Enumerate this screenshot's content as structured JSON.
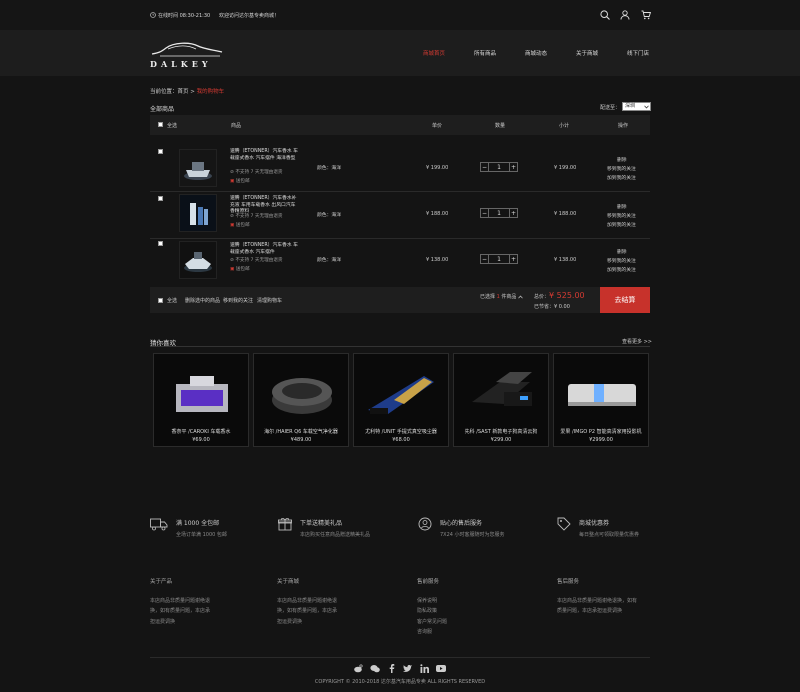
{
  "topbar": {
    "hours": "在线时间 08:30-21:30",
    "welcome": "欢迎访问达尔基专卖商城！"
  },
  "nav": {
    "logo_text": "DALKEY",
    "items": [
      {
        "label": "商城首页",
        "active": true
      },
      {
        "label": "所有商品",
        "active": false
      },
      {
        "label": "商城动态",
        "active": false
      },
      {
        "label": "关于商城",
        "active": false
      },
      {
        "label": "线下门店",
        "active": false
      }
    ]
  },
  "breadcrumb": {
    "prefix": "当前位置：",
    "home": "首页",
    "sep": ">",
    "current": "我的购物车"
  },
  "cart": {
    "heading": "全部商品",
    "ship_label": "配送至：",
    "ship_value": "深圳",
    "columns": [
      "全选",
      "商品",
      "单价",
      "数量",
      "小计",
      "操作"
    ],
    "items": [
      {
        "name": "速腾（ETONNER）汽车香水 车载座式香水 汽车摆件 海洋香型",
        "note": "不支持 7 天无理由退货",
        "gift": "送包邮",
        "spec": "颜色：海洋",
        "price": "¥ 199.00",
        "qty": "1",
        "subtotal": "¥ 199.00",
        "actions": [
          "删除",
          "移到我的关注",
          "加到我的关注"
        ]
      },
      {
        "name": "速腾（ETONNER）汽车香水补充液 车用车载香水 出风口汽车香精原料",
        "note": "不支持 7 天无理由退货",
        "gift": "送包邮",
        "spec": "颜色：海洋",
        "price": "¥ 188.00",
        "qty": "1",
        "subtotal": "¥ 188.00",
        "actions": [
          "删除",
          "移到我的关注",
          "加到我的关注"
        ]
      },
      {
        "name": "速腾（ETONNER）汽车香水 车载座式香水 汽车摆件",
        "note": "不支持 7 天无理由退货",
        "gift": "送包邮",
        "spec": "颜色：海洋",
        "price": "¥ 138.00",
        "qty": "1",
        "subtotal": "¥ 138.00",
        "actions": [
          "删除",
          "移到我的关注",
          "加到我的关注"
        ]
      }
    ],
    "footer": {
      "select_all": "全选",
      "delete_selected": "删除选中的商品",
      "move_follow": "移到我的关注",
      "clear": "清理购物车",
      "selected": "已选择",
      "selected_count": "1",
      "selected_unit": "件商品",
      "total_label": "总价：",
      "total": "¥ 525.00",
      "saved_label": "已节省：",
      "saved": "¥ 0.00",
      "checkout": "去结算"
    }
  },
  "recommend": {
    "title": "猜你喜欢",
    "more": "查看更多 >>",
    "items": [
      {
        "name": "香奈平 /CAROKI  车载香水",
        "price": "¥69.00"
      },
      {
        "name": "海尔 /HAIER Q6 车载空气净化器",
        "price": "¥489.00"
      },
      {
        "name": "尤利特 /UNIT 手提式真空吸尘器",
        "price": "¥68.00"
      },
      {
        "name": "先科 /SAST 新款电子狗高清云狗",
        "price": "¥299.00"
      },
      {
        "name": "爱果 /IMGO P2 智能高清家用投影机",
        "price": "¥2999.00"
      }
    ]
  },
  "services": [
    {
      "icon": "truck-icon",
      "title": "满 1000 全包邮",
      "sub": "全场订单满 1000 包邮"
    },
    {
      "icon": "gift-icon",
      "title": "下单送精美礼品",
      "sub": "本店购买任意商品赠送精美礼品"
    },
    {
      "icon": "headset-icon",
      "title": "贴心的售后服务",
      "sub": "7X24 小时客服随时为您服务"
    },
    {
      "icon": "tag-icon",
      "title": "商城优惠券",
      "sub": "每日整点可领取限量优惠券"
    }
  ],
  "footer_cols": [
    {
      "title": "关于产品",
      "lines": [
        "本店商品非质量问题谢绝退",
        "换，如有质量问题，本店承",
        "担运费调换"
      ]
    },
    {
      "title": "关于商城",
      "lines": [
        "本店商品非质量问题谢绝退",
        "换，如有质量问题，本店承",
        "担运费调换"
      ]
    },
    {
      "title": "售前服务",
      "lines": [
        "保养说明",
        "隐私政策",
        "客户常见问题",
        "咨询服"
      ]
    },
    {
      "title": "售后服务",
      "lines": [
        "本店商品非质量问题谢绝退换，如有",
        "质量问题，本店承担运费调换"
      ]
    }
  ],
  "copyright": "COPYRIGHT © 2010-2018 达尔基汽车用品专卖 ALL RIGHTS RESERVED",
  "colors": {
    "accent": "#d23a32",
    "bg": "#141414"
  }
}
